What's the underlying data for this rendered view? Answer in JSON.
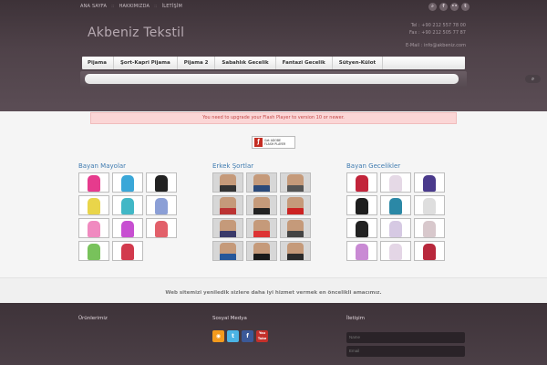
{
  "topnav": {
    "items": [
      "ANA SAYFA",
      "HAKKIMIZDA",
      "İLETİŞİM"
    ]
  },
  "social_top": [
    "search-icon",
    "facebook-icon",
    "flickr-icon",
    "twitter-icon"
  ],
  "site": {
    "logo": "Akbeniz Tekstil",
    "tel": "Tel : +90 212 557 78 00",
    "fax": "Fax : +90 212 505 77 87",
    "email": "E-Mail : info@akbeniz.com"
  },
  "menu": {
    "items": [
      "Pijama",
      "Şort-Kapri Pijama",
      "Pijama 2",
      "Sabahlık Gecelik",
      "Fantazi Gecelik",
      "Sütyen-Külot"
    ]
  },
  "search": {
    "placeholder": "",
    "button_icon": "search-icon"
  },
  "flash": {
    "warning": "You need to upgrade your Flash Player to version 10 or newer.",
    "badge_line1": "Get ADOBE",
    "badge_line2": "FLASH PLAYER"
  },
  "categories": [
    {
      "title": "Bayan Mayolar"
    },
    {
      "title": "Erkek Şortlar"
    },
    {
      "title": "Bayan Gecelikler"
    }
  ],
  "tagline": "Web sitemizi yeniledik sizlere daha iyi hizmet vermek en öncelikli amacımız.",
  "footer": {
    "col1_title": "Ürünlerimiz",
    "col2_title": "Sosyal Medya",
    "col3_title": "İletişim",
    "name_placeholder": "Name",
    "email_placeholder": "Email",
    "youtube_label": "You Tube"
  }
}
